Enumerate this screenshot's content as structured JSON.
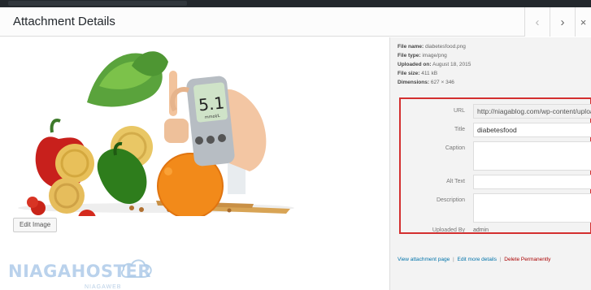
{
  "modal": {
    "title": "Attachment Details"
  },
  "nav": {
    "prev_icon": "‹",
    "next_icon": "›",
    "close_icon": "×"
  },
  "image_pane": {
    "edit_image_label": "Edit Image",
    "watermark_text": "NIAGAHOSTER",
    "watermark_sub": "NIAGAWEB",
    "photo_glucose_reading": "5.1",
    "photo_glucose_unit": "mmol/L"
  },
  "file_info": {
    "name_label": "File name:",
    "name_value": "diabetesfood.png",
    "type_label": "File type:",
    "type_value": "image/png",
    "uploaded_label": "Uploaded on:",
    "uploaded_value": "August 18, 2015",
    "size_label": "File size:",
    "size_value": "411 kB",
    "dimensions_label": "Dimensions:",
    "dimensions_value": "627 × 346"
  },
  "fields": {
    "url_label": "URL",
    "url_value": "http://niagablog.com/wp-content/uploa",
    "title_label": "Title",
    "title_value": "diabetesfood",
    "caption_label": "Caption",
    "alt_label": "Alt Text",
    "alt_value": "",
    "description_label": "Description",
    "uploaded_by_label": "Uploaded By",
    "uploaded_by_value": "admin"
  },
  "actions": {
    "view_label": "View attachment page",
    "edit_label": "Edit more details",
    "delete_label": "Delete Permanently",
    "separator": "|"
  },
  "colors": {
    "highlight_border": "#d32f2f",
    "link": "#0073aa",
    "delete": "#aa0000"
  }
}
